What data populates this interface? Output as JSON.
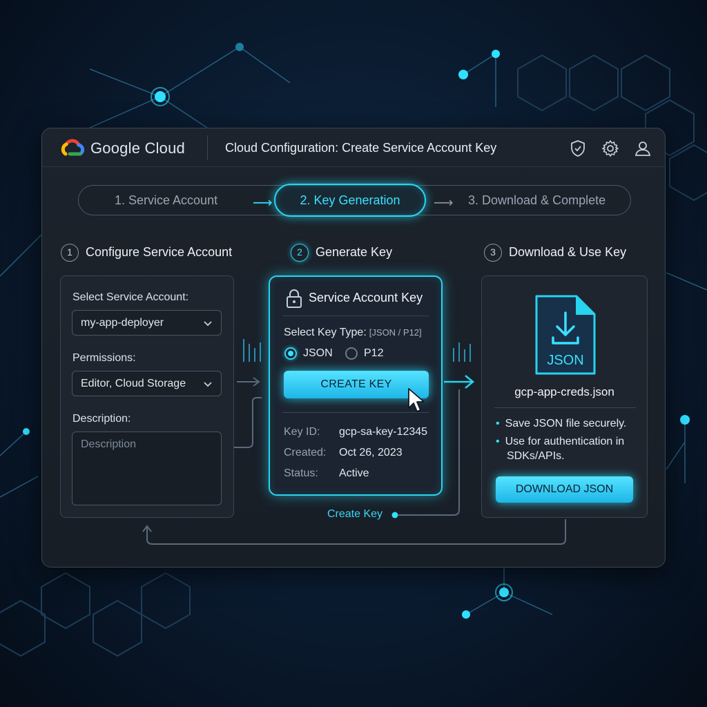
{
  "app": {
    "brand": "Google Cloud",
    "window_title": "Cloud Configuration: Create Service Account Key"
  },
  "toolbar": {
    "icons": [
      "shield-check-icon",
      "gear-icon",
      "user-icon"
    ]
  },
  "stepper": {
    "steps": [
      {
        "label": "1. Service Account",
        "state": "done"
      },
      {
        "label": "2. Key Generation",
        "state": "active"
      },
      {
        "label": "3. Download & Complete",
        "state": "pending"
      }
    ]
  },
  "sections": {
    "configure": {
      "number": "1",
      "title": "Configure Service Account"
    },
    "generate": {
      "number": "2",
      "title": "Generate Key"
    },
    "download": {
      "number": "3",
      "title": "Download & Use Key"
    }
  },
  "configure_card": {
    "service_account_label": "Select Service Account:",
    "service_account_value": "my-app-deployer",
    "permissions_label": "Permissions:",
    "permissions_value": "Editor, Cloud Storage",
    "description_label": "Description:",
    "description_placeholder": "Description"
  },
  "key_card": {
    "title": "Service Account Key",
    "key_type_label": "Select Key Type:",
    "key_type_hint": "[JSON / P12]",
    "options": [
      "JSON",
      "P12"
    ],
    "selected_option": "JSON",
    "create_button": "CREATE KEY",
    "key_id_label": "Key ID:",
    "key_id_value": "gcp-sa-key-12345",
    "created_label": "Created:",
    "created_value": "Oct 26, 2023",
    "status_label": "Status:",
    "status_value": "Active"
  },
  "download_card": {
    "file_type": "JSON",
    "file_name": "gcp-app-creds.json",
    "bullets": [
      "Save JSON file securely.",
      "Use for authentication in SDKs/APIs."
    ],
    "download_button": "DOWNLOAD JSON"
  },
  "flow": {
    "create_key_label": "Create Key"
  },
  "colors": {
    "accent": "#27d4f0",
    "panel": "#1c232c",
    "background": "#0a1a2e"
  }
}
